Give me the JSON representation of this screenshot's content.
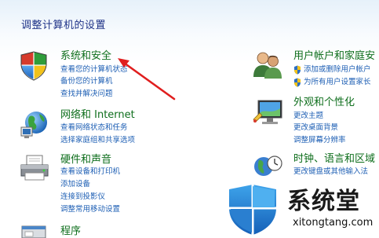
{
  "page_title": "调整计算机的设置",
  "categories": [
    {
      "icon": "system-security-shield-icon",
      "title": "系统和安全",
      "links": [
        "查看您的计算机状态",
        "备份您的计算机",
        "查找并解决问题"
      ]
    },
    {
      "icon": "network-globe-icon",
      "title": "网络和 Internet",
      "links": [
        "查看网络状态和任务",
        "选择家庭组和共享选项"
      ]
    },
    {
      "icon": "printer-icon",
      "title": "硬件和声音",
      "links": [
        "查看设备和打印机",
        "添加设备",
        "连接到投影仪",
        "调整常用移动设置"
      ]
    },
    {
      "icon": "programs-icon",
      "title": "程序",
      "links": []
    },
    {
      "icon": "users-icon",
      "title": "用户帐户和家庭安",
      "links": [
        "添加或删除用户帐户",
        "为所有用户设置家长"
      ]
    },
    {
      "icon": "appearance-monitor-icon",
      "title": "外观和个性化",
      "links": [
        "更改主题",
        "更改桌面背景",
        "调整屏幕分辨率"
      ]
    },
    {
      "icon": "clock-language-globe-icon",
      "title": "时钟、语言和区域",
      "links": [
        "更改键盘或其他输入法"
      ]
    }
  ],
  "watermark": {
    "brand": "系统堂",
    "url": "xitongtang.com",
    "logo": "windows-shield-logo"
  },
  "colors": {
    "title_text": "#1e3287",
    "category_title": "#0e6e1c",
    "link": "#1e5fb4",
    "annotation_arrow": "#e01e1e"
  }
}
